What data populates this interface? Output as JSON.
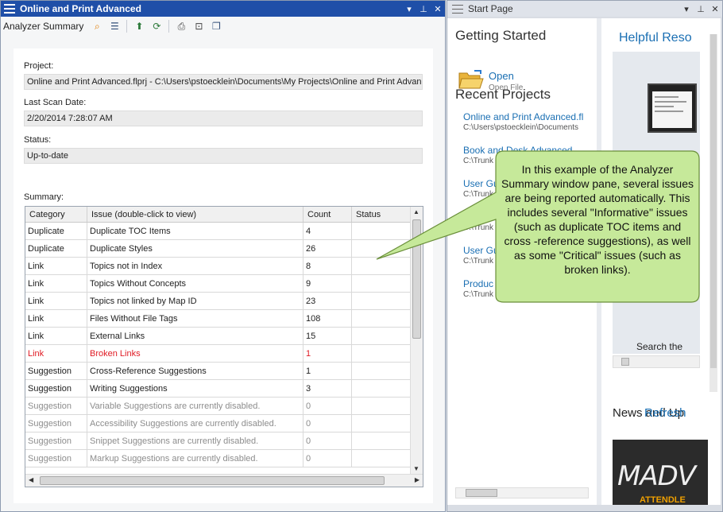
{
  "left_pane": {
    "title": "Online and Print Advanced",
    "toolbar_label": "Analyzer Summary",
    "project_label": "Project:",
    "project_value": "Online and Print Advanced.flprj - C:\\Users\\pstoecklein\\Documents\\My Projects\\Online and Print Advanced",
    "last_scan_label": "Last Scan Date:",
    "last_scan_value": "2/20/2014 7:28:07 AM",
    "status_label": "Status:",
    "status_value": "Up-to-date",
    "summary_label": "Summary:",
    "columns": [
      "Category",
      "Issue (double-click to view)",
      "Count",
      "Status"
    ],
    "rows": [
      {
        "category": "Duplicate",
        "issue": "Duplicate TOC Items",
        "count": "4",
        "state": "normal"
      },
      {
        "category": "Duplicate",
        "issue": "Duplicate Styles",
        "count": "26",
        "state": "normal"
      },
      {
        "category": "Link",
        "issue": "Topics not in Index",
        "count": "8",
        "state": "normal"
      },
      {
        "category": "Link",
        "issue": "Topics Without Concepts",
        "count": "9",
        "state": "normal"
      },
      {
        "category": "Link",
        "issue": "Topics not linked by Map ID",
        "count": "23",
        "state": "normal"
      },
      {
        "category": "Link",
        "issue": "Files Without File Tags",
        "count": "108",
        "state": "normal"
      },
      {
        "category": "Link",
        "issue": "External Links",
        "count": "15",
        "state": "normal"
      },
      {
        "category": "Link",
        "issue": "Broken Links",
        "count": "1",
        "state": "critical"
      },
      {
        "category": "Suggestion",
        "issue": "Cross-Reference Suggestions",
        "count": "1",
        "state": "normal"
      },
      {
        "category": "Suggestion",
        "issue": "Writing Suggestions",
        "count": "3",
        "state": "normal"
      },
      {
        "category": "Suggestion",
        "issue": "Variable Suggestions are currently disabled.",
        "count": "0",
        "state": "disabled"
      },
      {
        "category": "Suggestion",
        "issue": "Accessibility Suggestions are currently disabled.",
        "count": "0",
        "state": "disabled"
      },
      {
        "category": "Suggestion",
        "issue": "Snippet Suggestions are currently disabled.",
        "count": "0",
        "state": "disabled"
      },
      {
        "category": "Suggestion",
        "issue": "Markup Suggestions are currently disabled.",
        "count": "0",
        "state": "disabled"
      }
    ]
  },
  "right_pane": {
    "title": "Start Page",
    "getting_started": "Getting Started",
    "open_label": "Open",
    "open_sub": "Open File",
    "recent_projects": "Recent Projects",
    "recent": [
      {
        "name": "Online and Print Advanced.fl",
        "path": "C:\\Users\\pstoecklein\\Documents"
      },
      {
        "name": "Book and Desk Advanced",
        "path": "C:\\Trunk"
      },
      {
        "name": "User Gu",
        "path": "C:\\Trunk"
      },
      {
        "name": "C",
        "path": "C:\\Trunk"
      },
      {
        "name": "User Gu",
        "path": "C:\\Trunk"
      },
      {
        "name": "Produc",
        "path": "C:\\Trunk"
      }
    ],
    "helpful": "Helpful Reso",
    "search_the": "Search the",
    "news": "News and Up",
    "news_overlap": "Refresh",
    "news_image_text": "MADV",
    "news_image_sub": "ATTENDLE"
  },
  "callout": {
    "text": "In this example of the Analyzer Summary window pane, several issues are being reported automatically. This includes several \"Informative\" issues (such as duplicate TOC items  and cross -reference suggestions), as well as some \"Critical\" issues (such as broken links)."
  },
  "colors": {
    "active_title": "#1f4fa8",
    "link_blue": "#1a6fb3",
    "critical_red": "#e01b24",
    "callout_fill": "#c6e99a",
    "callout_border": "#6a8f3a"
  }
}
